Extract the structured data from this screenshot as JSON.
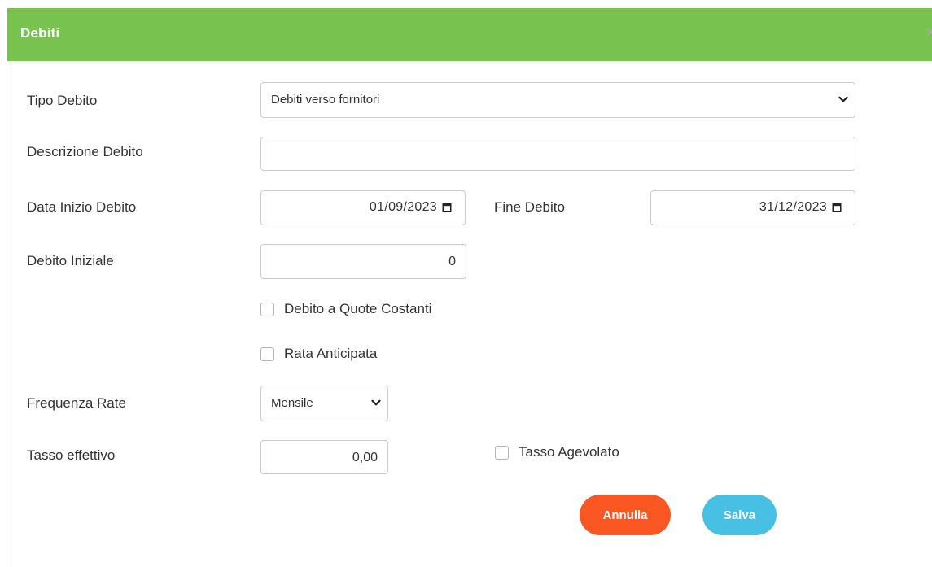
{
  "modal": {
    "title": "Debiti",
    "close_label": "×"
  },
  "form": {
    "tipo_debito": {
      "label": "Tipo Debito",
      "value": "Debiti verso fornitori"
    },
    "descrizione": {
      "label": "Descrizione Debito",
      "value": ""
    },
    "data_inizio": {
      "label": "Data Inizio Debito",
      "value": "01/09/2023"
    },
    "fine_debito": {
      "label": "Fine Debito",
      "value": "31/12/2023"
    },
    "debito_iniziale": {
      "label": "Debito Iniziale",
      "value": "0"
    },
    "quote_costanti": {
      "label": "Debito a Quote Costanti",
      "checked": false
    },
    "rata_anticipata": {
      "label": "Rata Anticipata",
      "checked": false
    },
    "frequenza_rate": {
      "label": "Frequenza Rate",
      "value": "Mensile"
    },
    "tasso_effettivo": {
      "label": "Tasso effettivo",
      "value": "0,00"
    },
    "tasso_agevolato": {
      "label": "Tasso Agevolato",
      "checked": false
    }
  },
  "buttons": {
    "cancel_label": "Annulla",
    "save_label": "Salva"
  },
  "colors": {
    "header": "#78c350",
    "cancel": "#fb5722",
    "save": "#47c0e3"
  },
  "icons": [
    "close-icon",
    "chevron-down-icon",
    "calendar-icon"
  ]
}
